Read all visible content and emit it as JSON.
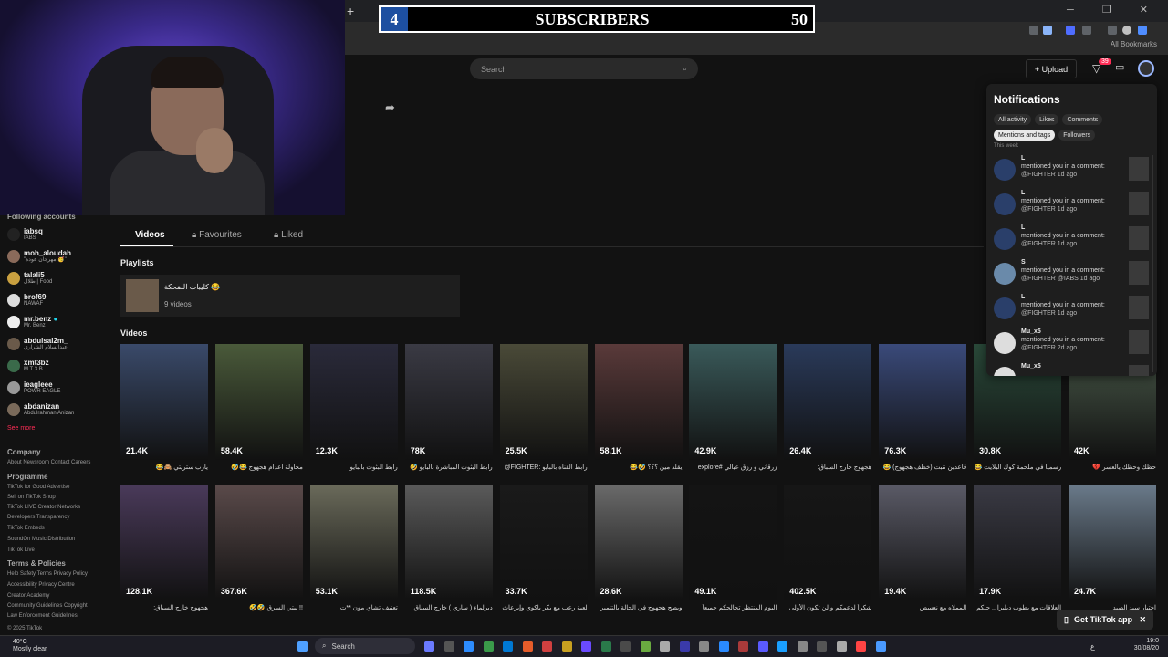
{
  "overlay": {
    "count": "4",
    "label": "SUBSCRIBERS",
    "goal": "50"
  },
  "browser": {
    "new_tab": "+",
    "bookmarks": "All Bookmarks",
    "window_controls": "─ ❐ ✕"
  },
  "header": {
    "search_placeholder": "Search",
    "upload_label": "+ Upload",
    "inbox_badge": "39"
  },
  "sidebar": {
    "following_title": "Following accounts",
    "accounts": [
      {
        "name": "iabsq",
        "sub": "IABS"
      },
      {
        "name": "moh_aloudah",
        "sub": "\"مهرجان عودة 🥳\""
      },
      {
        "name": "talali5",
        "sub": "طلال | Food"
      },
      {
        "name": "brof69",
        "sub": "NAWAF"
      },
      {
        "name": "mr.benz",
        "sub": "Mr. Benz"
      },
      {
        "name": "abdulsal2m_",
        "sub": "عبدالسلام الشراري"
      },
      {
        "name": "xmt3bz",
        "sub": "M T 3 B"
      },
      {
        "name": "ieagleee",
        "sub": "POWR EAGLE"
      },
      {
        "name": "abdanizan",
        "sub": "Abdulrahman Anizan"
      }
    ],
    "see_more": "See more",
    "company_head": "Company",
    "company_links": "About  Newsroom  Contact  Careers",
    "programme_head": "Programme",
    "programme_links": [
      "TikTok for Good  Advertise",
      "Sell on TikTok Shop",
      "TikTok LIVE Creator Networks",
      "Developers  Transparency",
      "TikTok Embeds",
      "SoundOn Music Distribution",
      "TikTok Live"
    ],
    "terms_head": "Terms & Policies",
    "terms_links": [
      "Help  Safety  Terms  Privacy Policy",
      "Accessibility  Privacy Centre",
      "Creator Academy",
      "Community Guidelines  Copyright",
      "Law Enforcement Guidelines"
    ],
    "copyright": "© 2025 TikTok"
  },
  "tabs": {
    "videos": "Videos",
    "favourites": "Favourites",
    "liked": "Liked"
  },
  "playlists": {
    "heading": "Playlists",
    "title": "كليبات الضحكة 😂",
    "count": "9 videos"
  },
  "videos_heading": "Videos",
  "videos_row1": [
    {
      "views": "21.4K",
      "caption": "يارب ستريتي 🙈😂",
      "color": "#3a4a6a"
    },
    {
      "views": "58.4K",
      "caption": "محاولة اعدام هجهوج 😂🤣",
      "color": "#4a5a3a"
    },
    {
      "views": "12.3K",
      "caption": "رابط البثوت بالبايو",
      "color": "#2a2a3a"
    },
    {
      "views": "78K",
      "caption": "رابط البثوت المباشرة بالبايو 🤣",
      "color": "#3a3a44"
    },
    {
      "views": "25.5K",
      "caption": "رابط القناه بالبايو :FIGHTER@",
      "color": "#4a4a38"
    },
    {
      "views": "58.1K",
      "caption": "يقلد مين ؟؟؟ 🤣😂",
      "color": "#5a3a3a"
    },
    {
      "views": "42.9K",
      "caption": "زرقاني و رزق عيالي #explore",
      "color": "#3a5a5a"
    },
    {
      "views": "26.4K",
      "caption": "هجهوج خارج السباق:",
      "color": "#2a3a5a"
    },
    {
      "views": "76.3K",
      "caption": "قاعدين ننبت (خطف هجهوج) 😂",
      "color": "#3a4a7a"
    },
    {
      "views": "30.8K",
      "caption": "رسمياً في ملحمة كوك البلايت 😂",
      "color": "#2a4a3a"
    },
    {
      "views": "42K",
      "caption": "حظك وحظك يالعسر 💔",
      "color": "#4a5a4a"
    }
  ],
  "videos_row2": [
    {
      "views": "128.1K",
      "caption": "هجهوج خارج السباق:",
      "color": "#4a3a5a"
    },
    {
      "views": "367.6K",
      "caption": "!! بيتي السرق 🤣🤣",
      "color": "#5a4a4a"
    },
    {
      "views": "53.1K",
      "caption": "تعنيف تشاي مون **ت",
      "color": "#6a6a5a"
    },
    {
      "views": "118.5K",
      "caption": "ديرلماء ( ساري ) خارج السباق",
      "color": "#5a5a5a"
    },
    {
      "views": "33.7K",
      "caption": "لعبة رعب مع بكر باكوي وإبرعاث",
      "color": "#1a1a1a"
    },
    {
      "views": "28.6K",
      "caption": "ويصح هجهوج في الحالة بالتنمير",
      "color": "#6a6a6a"
    },
    {
      "views": "49.1K",
      "caption": "اليوم المنتظر تحالجكم جميعاً",
      "color": "#141414"
    },
    {
      "views": "402.5K",
      "caption": "شكراً لدعمكم و لن تكون الأولى",
      "color": "#161616"
    },
    {
      "views": "19.4K",
      "caption": "المملاه مع نعسص",
      "color": "#5a5a66"
    },
    {
      "views": "17.9K",
      "caption": "العلاقات مع يطوب ديلبرا .. جيكم",
      "color": "#3a3a44"
    },
    {
      "views": "24.7K",
      "caption": "اختبار سيد الصيد",
      "color": "#6a7a8a"
    }
  ],
  "notifications": {
    "title": "Notifications",
    "filters": [
      "All activity",
      "Likes",
      "Comments"
    ],
    "filters2": [
      "Mentions and tags",
      "Followers"
    ],
    "this_week": "This week",
    "items": [
      {
        "name": "L",
        "text": "mentioned you in a comment:",
        "meta": "@FIGHTER 1d ago"
      },
      {
        "name": "L",
        "text": "mentioned you in a comment:",
        "meta": "@FIGHTER 1d ago"
      },
      {
        "name": "L",
        "text": "mentioned you in a comment:",
        "meta": "@FIGHTER 1d ago"
      },
      {
        "name": "S",
        "text": "mentioned you in a comment:",
        "meta": "@FIGHTER @IABS 1d ago"
      },
      {
        "name": "L",
        "text": "mentioned you in a comment:",
        "meta": "@FIGHTER 1d ago"
      },
      {
        "name": "Mu_x5",
        "text": "mentioned you in a comment:",
        "meta": "@FIGHTER 2d ago"
      },
      {
        "name": "Mu_x5",
        "text": "",
        "meta": ""
      }
    ]
  },
  "get_app": "Get TikTok app",
  "taskbar": {
    "temp": "40°C",
    "weather": "Mostly clear",
    "search": "Search",
    "time": "19:0",
    "date": "30/08/20",
    "lang": "ع"
  }
}
